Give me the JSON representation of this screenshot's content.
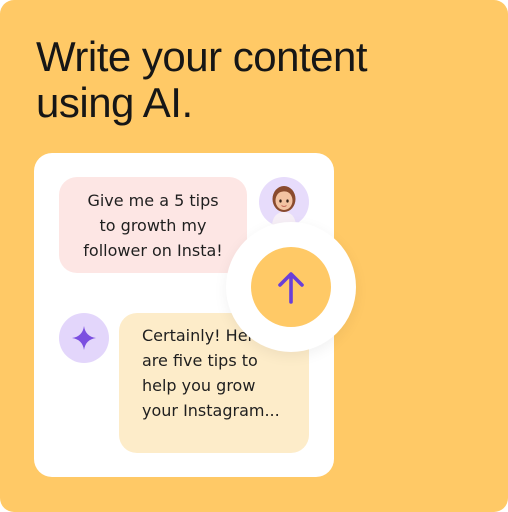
{
  "headline": {
    "line1": "Write your content",
    "line2": "using AI."
  },
  "chat": {
    "user_message": {
      "lines": [
        "Give me a 5 tips",
        "to growth my",
        "follower on Insta!"
      ]
    },
    "ai_message": {
      "lines": [
        "Certainly! Here",
        "are five tips to",
        "help you grow",
        "your Instagram..."
      ]
    },
    "icons": {
      "user_avatar": "user-avatar",
      "ai_badge": "sparkle-icon",
      "send": "arrow-up-icon"
    }
  },
  "colors": {
    "background": "#FFC966",
    "panel": "#FFFFFF",
    "user_bubble": "#FDE6E4",
    "ai_bubble": "#FDECC9",
    "accent_purple": "#7B4FE0",
    "badge_lavender": "#E3D6FB"
  }
}
